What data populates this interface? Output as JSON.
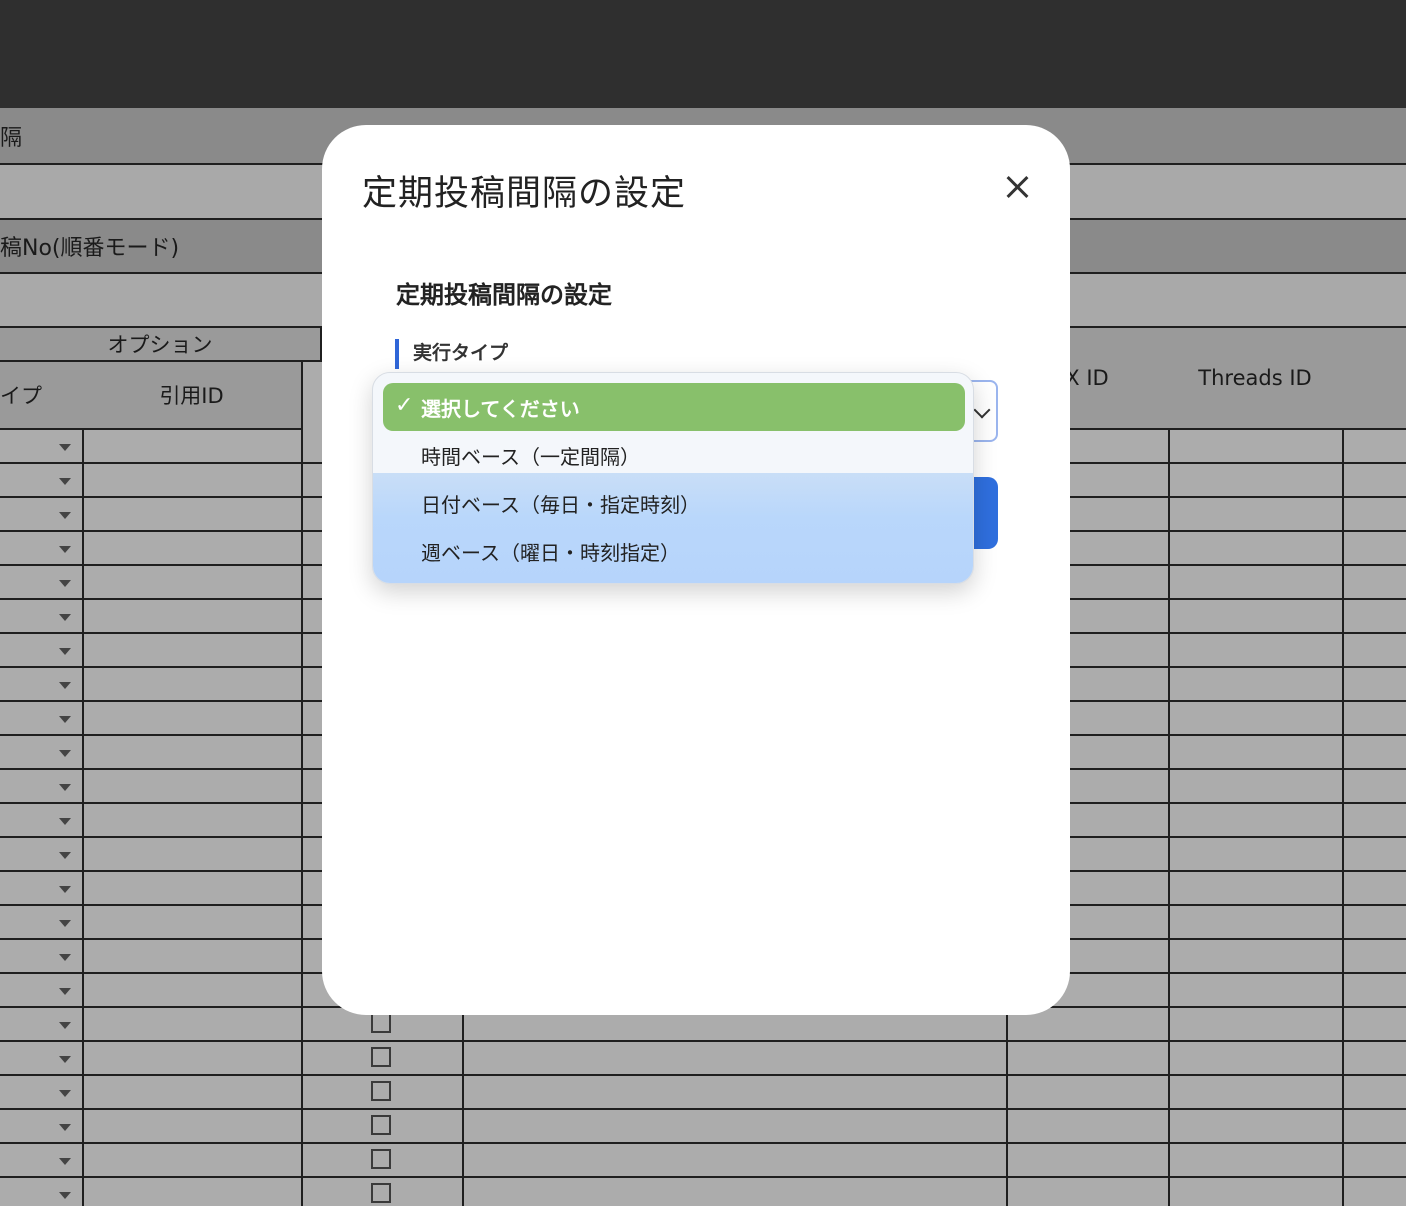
{
  "sheet": {
    "row_interval_label": "隔",
    "row_post_no_label": "稿No(順番モード)",
    "header_group_option": "オプション",
    "col_type_partial": "イプ",
    "col_quote_id": "引用ID",
    "col_x_id": "X ID",
    "col_threads_id": "Threads ID"
  },
  "modal": {
    "title": "定期投稿間隔の設定",
    "section_title": "定期投稿間隔の設定",
    "field_label": "実行タイプ"
  },
  "dropdown": {
    "options": [
      {
        "label": "選択してください",
        "selected": true
      },
      {
        "label": "時間ベース（一定間隔）",
        "selected": false
      },
      {
        "label": "日付ベース（毎日・指定時刻）",
        "selected": false
      },
      {
        "label": "週ベース（曜日・時刻指定）",
        "selected": false
      }
    ]
  }
}
